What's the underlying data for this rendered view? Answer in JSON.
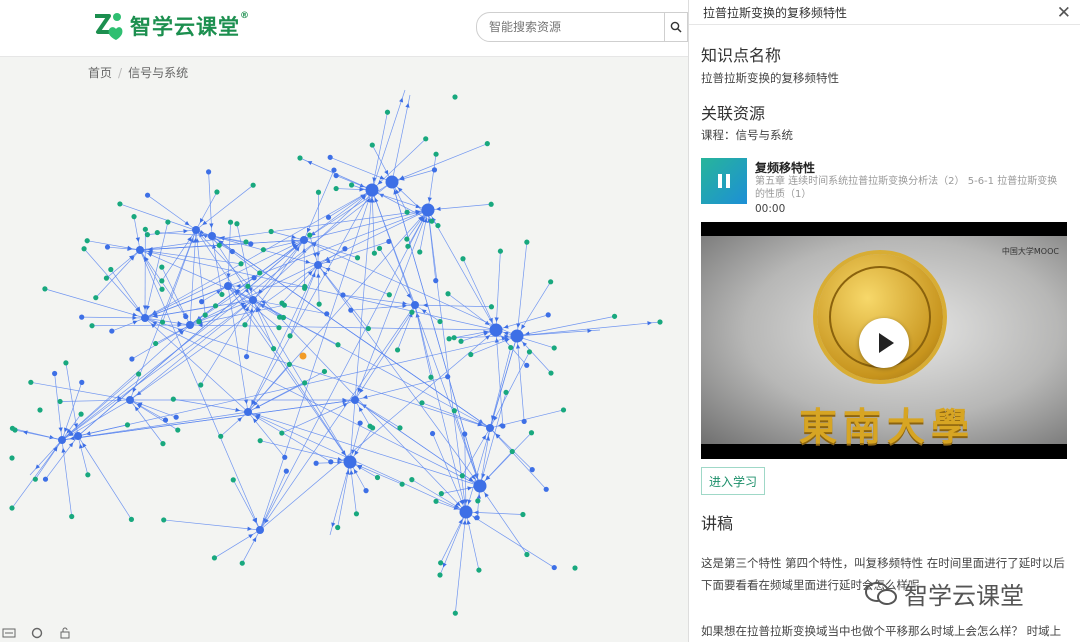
{
  "header": {
    "brand": "智学云课堂",
    "reg_mark": "®",
    "search_placeholder": "智能搜索资源"
  },
  "breadcrumb": {
    "home": "首页",
    "separator": "/",
    "current": "信号与系统"
  },
  "panel": {
    "title": "拉普拉斯变换的复移频特性",
    "section_kp": "知识点名称",
    "kp_name": "拉普拉斯变换的复移频特性",
    "section_res": "关联资源",
    "course": "课程：信号与系统",
    "resource": {
      "title": "复频移特性",
      "subtitle": "第五章 连续时间系统拉普拉斯变换分析法（2） 5-6-1 拉普拉斯变换的性质（1）",
      "time": "00:00"
    },
    "video": {
      "school": "東南大學",
      "mooc_label": "中国大学MOOC"
    },
    "enter_label": "进入学习",
    "section_lecture": "讲稿",
    "lecture_p1": "这是第三个特性 第四个特性，叫复移频特性 在时间里面进行了延时以后下面要看看在频域里面进行延时会怎么样呢",
    "lecture_p2": "如果想在拉普拉斯变换域当中也做个平移那么时域上会怎么样？ 时域上相当于"
  },
  "watermark": {
    "text": "智学云课堂"
  },
  "colors": {
    "brand_green": "#1c8f4f",
    "node_blue": "#3d6fe6",
    "node_green": "#18a87e",
    "edge_blue": "#5b86f0",
    "highlight": "#f29b26"
  },
  "icons": [
    "search-icon",
    "close-icon",
    "pause-icon",
    "play-icon"
  ]
}
